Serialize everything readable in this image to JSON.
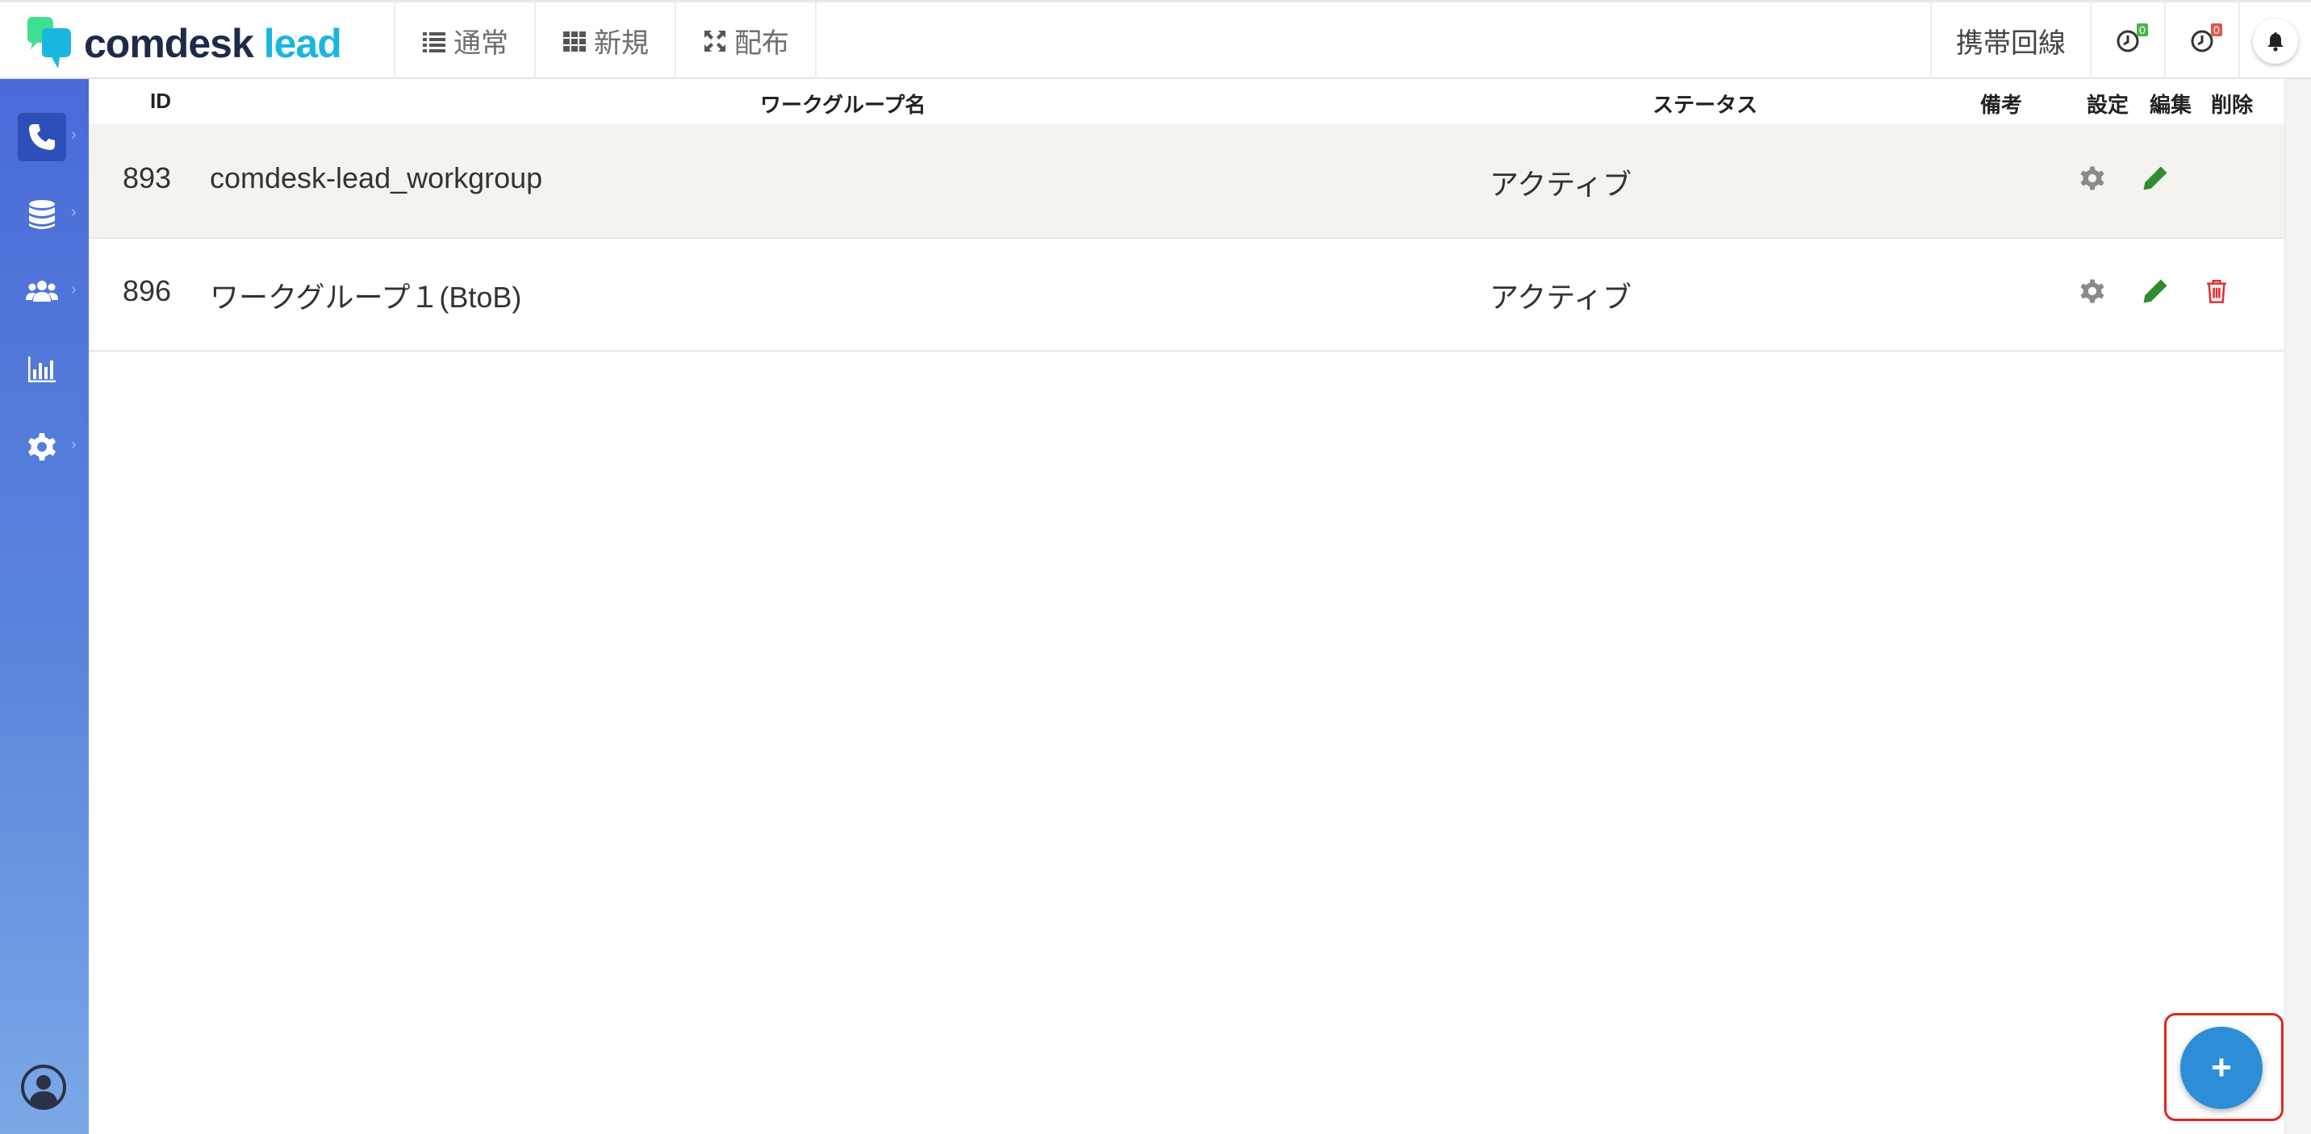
{
  "app": {
    "logo_part1": "comdesk",
    "logo_part2": "lead",
    "brand_color": "#19b6e0"
  },
  "nav": [
    {
      "label": "通常",
      "icon": "list-icon"
    },
    {
      "label": "新規",
      "icon": "grid-icon"
    },
    {
      "label": "配布",
      "icon": "arrows-expand-icon"
    }
  ],
  "header_right": {
    "mobile_line": "携帯回線",
    "clock_green_badge": "0",
    "clock_red_badge": "0"
  },
  "sidebar": [
    {
      "name": "phone",
      "icon": "phone-icon",
      "active": true
    },
    {
      "name": "database",
      "icon": "database-icon"
    },
    {
      "name": "users",
      "icon": "users-icon"
    },
    {
      "name": "reports",
      "icon": "bar-chart-icon"
    },
    {
      "name": "settings",
      "icon": "gear-icon"
    }
  ],
  "table": {
    "headers": {
      "id": "ID",
      "name": "ワークグループ名",
      "status": "ステータス",
      "note": "備考",
      "settings": "設定",
      "edit": "編集",
      "delete": "削除"
    },
    "rows": [
      {
        "id": "893",
        "name": "comdesk-lead_workgroup",
        "status": "アクティブ",
        "note": "",
        "deletable": false
      },
      {
        "id": "896",
        "name": "ワークグループ１(BtoB)",
        "status": "アクティブ",
        "note": "",
        "deletable": true
      }
    ]
  },
  "fab": {
    "label": "+"
  },
  "colors": {
    "edit_icon": "#2e8b2e",
    "delete_icon": "#e03030",
    "settings_icon": "#8a8a8a",
    "fab": "#2c8ed6",
    "highlight_frame": "#e0261c"
  }
}
